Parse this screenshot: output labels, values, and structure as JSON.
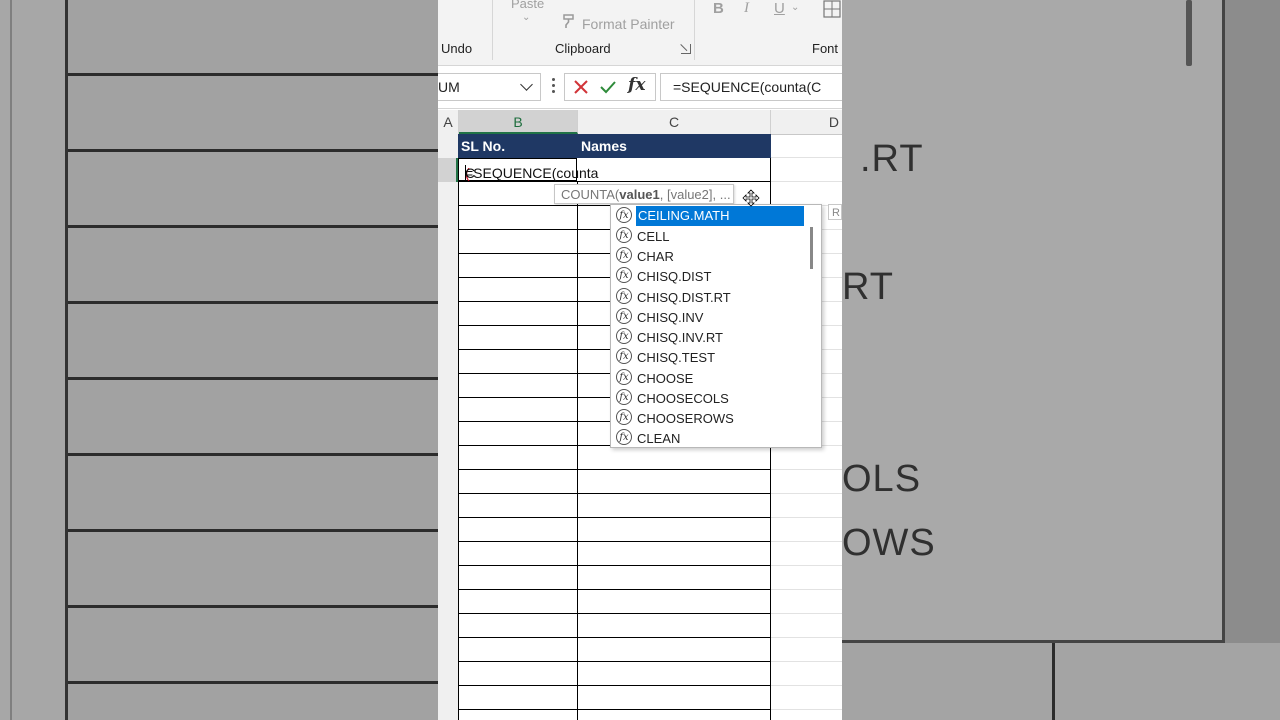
{
  "ribbon": {
    "paste_label": "Paste",
    "format_painter_label": "Format Painter",
    "undo_group": "Undo",
    "clipboard_group": "Clipboard",
    "font_group": "Font",
    "bold": "B",
    "italic": "I",
    "underline": "U"
  },
  "formula_bar": {
    "name_box": "UM",
    "formula": "=SEQUENCE(counta(C",
    "fx_label": "fx"
  },
  "columns": [
    "A",
    "B",
    "C",
    "D"
  ],
  "table": {
    "header_sl": "SL No.",
    "header_names": "Names"
  },
  "active_cell": {
    "text_before": "=SEQUENCE(counta",
    "paren": "(",
    "text_after": "C"
  },
  "tooltip": {
    "fn": "COUNTA(",
    "arg1": "value1",
    "rest": ", [value2], ..."
  },
  "autocomplete": {
    "items": [
      "CEILING.MATH",
      "CELL",
      "CHAR",
      "CHISQ.DIST",
      "CHISQ.DIST.RT",
      "CHISQ.INV",
      "CHISQ.INV.RT",
      "CHISQ.TEST",
      "CHOOSE",
      "CHOOSECOLS",
      "CHOOSEROWS",
      "CLEAN"
    ],
    "highlighted": "CEILING.MATH",
    "side_box": "R"
  },
  "background_text": [
    ".RT",
    "RT",
    "OLS",
    "OWS"
  ],
  "colors": {
    "header_fill": "#1f3864",
    "selection_blue": "#0078d7",
    "excel_green": "#217346"
  }
}
